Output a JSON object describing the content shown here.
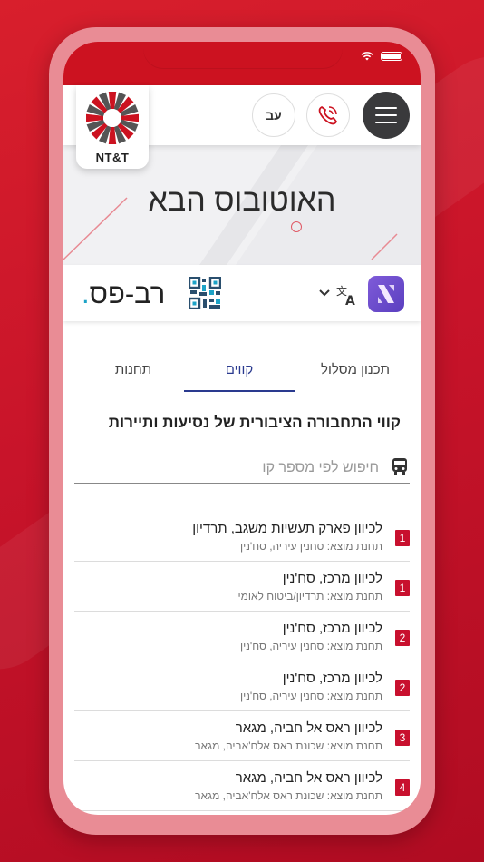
{
  "colors": {
    "brand_red": "#cc1220",
    "accent_blue": "#2a3a8f",
    "badge_red": "#c8102e",
    "ravpas_dot": "#1ca3c7"
  },
  "header": {
    "menu_icon": "hamburger-icon",
    "call_icon": "phone-call-icon",
    "lang_label": "עב",
    "logo_text": "NT&T"
  },
  "hero": {
    "title": "האוטובוס הבא"
  },
  "brandbar": {
    "app_icon": "app-x-icon",
    "translate_icon": "translate-icon",
    "qr_icon": "qr-code-icon",
    "ravpas_text": "רב-פס",
    "ravpas_dot": "."
  },
  "tabs": [
    {
      "label": "תכנון מסלול",
      "active": false
    },
    {
      "label": "קווים",
      "active": true
    },
    {
      "label": "תחנות",
      "active": false
    }
  ],
  "section_title": "קווי התחבורה הציבורית של נסיעות ותיירות",
  "search": {
    "placeholder": "חיפוש לפי מספר קו",
    "value": ""
  },
  "lines": [
    {
      "number": "1",
      "title": "לכיוון פארק תעשיות משגב, תרדיון",
      "origin": "תחנת מוצא: סחנין עיריה, סח'נין"
    },
    {
      "number": "1",
      "title": "לכיוון מרכז, סח'נין",
      "origin": "תחנת מוצא: תרדיון/ביטוח לאומי"
    },
    {
      "number": "2",
      "title": "לכיוון מרכז, סח'נין",
      "origin": "תחנת מוצא: סחנין עיריה, סח'נין"
    },
    {
      "number": "2",
      "title": "לכיוון מרכז, סח'נין",
      "origin": "תחנת מוצא: סחנין עיריה, סח'נין"
    },
    {
      "number": "3",
      "title": "לכיוון ראס אל חביה, מגאר",
      "origin": "תחנת מוצא: שכונת ראס אלח'אביה, מגאר"
    },
    {
      "number": "4",
      "title": "לכיוון ראס אל חביה, מגאר",
      "origin": "תחנת מוצא: שכונת ראס אלח'אביה, מגאר"
    }
  ]
}
